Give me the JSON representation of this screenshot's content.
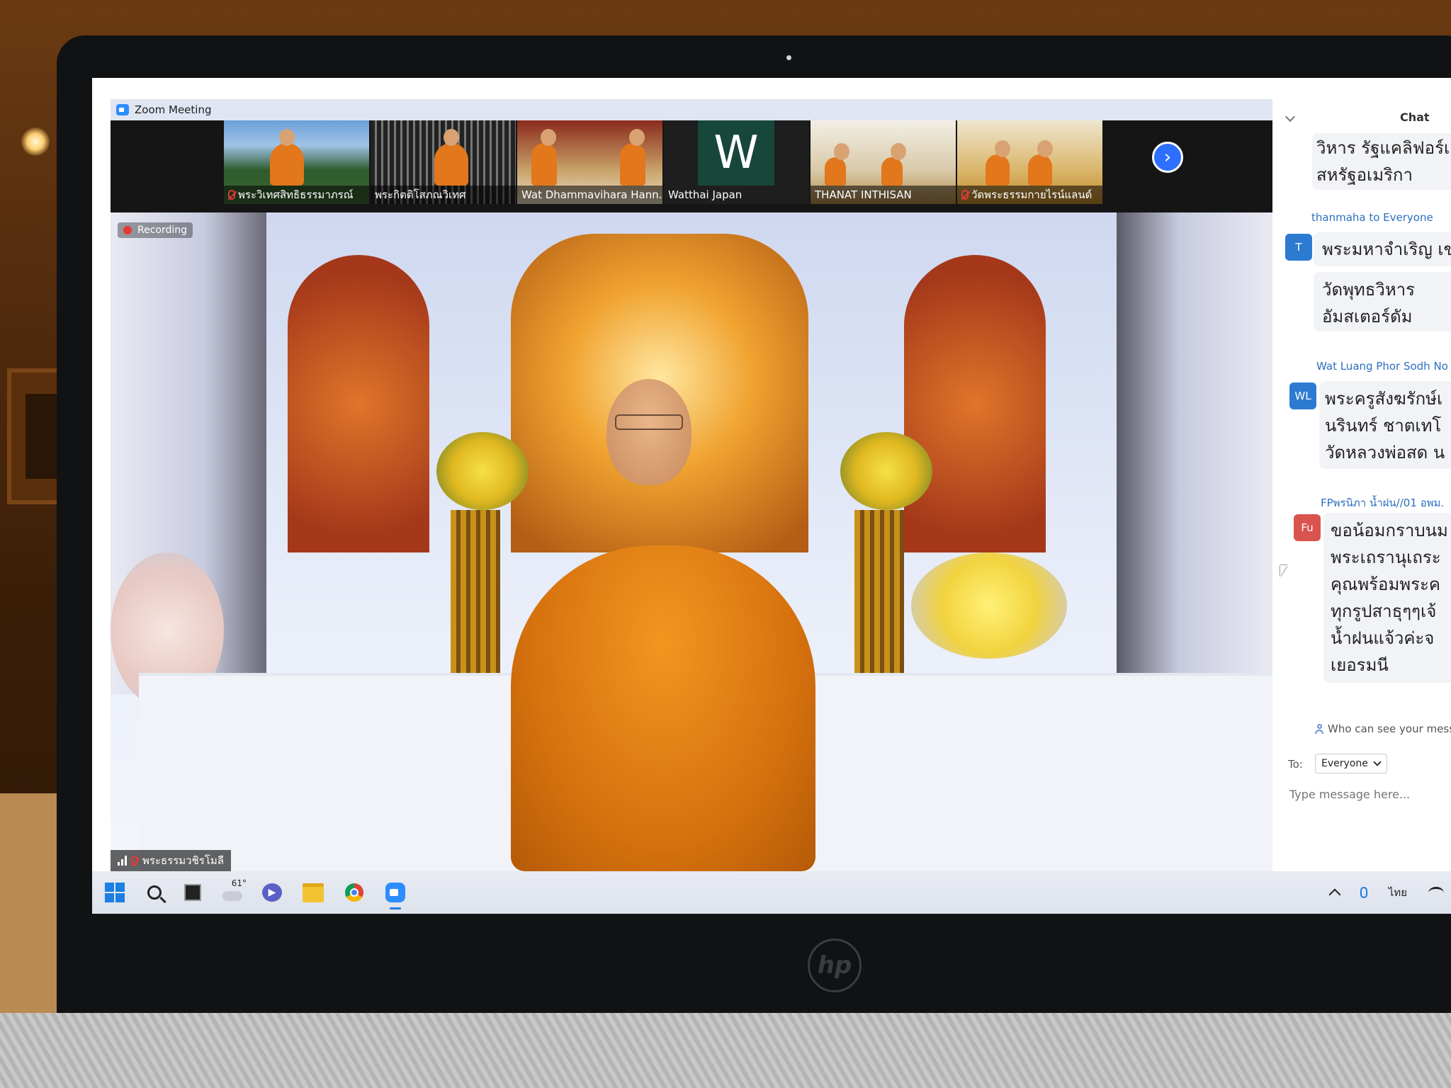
{
  "window": {
    "title": "Zoom Meeting"
  },
  "gallery": {
    "participants": [
      {
        "name": "พระวิเทศสิทธิธรรมาภรณ์",
        "muted": true
      },
      {
        "name": "พระกิตติโสภณวิเทศ",
        "muted": false
      },
      {
        "name": "Wat Dhammavihara Hann...",
        "muted": false
      },
      {
        "name": "Watthai Japan",
        "muted": false,
        "avatar_letter": "W"
      },
      {
        "name": "THANAT INTHISAN",
        "muted": false
      },
      {
        "name": "วัดพระธรรมกายไรน์แลนด์",
        "muted": true
      }
    ],
    "next_page_icon": "chevron-right-icon"
  },
  "main_video": {
    "recording_label": "Recording",
    "speaker_name": "พระธรรมวชิรโมลี",
    "speaker_muted": true
  },
  "chat": {
    "title": "Chat",
    "messages": [
      {
        "sender": "",
        "lines": [
          "วิหาร รัฐแคลิฟอร์เ",
          "สหรัฐอเมริกา"
        ]
      },
      {
        "sender": "thanmaha to Everyone",
        "avatar": "T",
        "avatar_color": "#2d7bd1",
        "lines": [
          "พระมหาจำเริญ เข",
          "วัดพุทธวิหาร",
          "อัมสเตอร์ดัม"
        ]
      },
      {
        "sender": "Wat Luang Phor Sodh No",
        "avatar": "WL",
        "avatar_color": "#2d7bd1",
        "lines": [
          "พระครูสังฆรักษ์เ",
          "นรินทร์ ชาตเทโ",
          "วัดหลวงพ่อสด น"
        ]
      },
      {
        "sender": "FPพรนิภา น้ำฝน//01 อพม.",
        "avatar": "Fu",
        "avatar_color": "#d9534f",
        "lines": [
          "ขอน้อมกราบนม",
          "พระเถรานุเถระ",
          "คุณพร้อมพระค",
          "ทุกรูปสาธุๆๆเจ้",
          "น้ำฝนแจ้วค่ะจ",
          "เยอรมนี"
        ]
      }
    ],
    "who_can_see": "Who can see your messa",
    "to_label": "To:",
    "to_value": "Everyone",
    "input_placeholder": "Type message here..."
  },
  "taskbar": {
    "weather_temp": "61°",
    "language": "ไทย",
    "apps": [
      "start-icon",
      "search-icon",
      "task-view-icon",
      "weather-icon",
      "chat-icon",
      "file-explorer-icon",
      "chrome-icon",
      "zoom-icon"
    ]
  },
  "laptop": {
    "logo": "hp"
  }
}
